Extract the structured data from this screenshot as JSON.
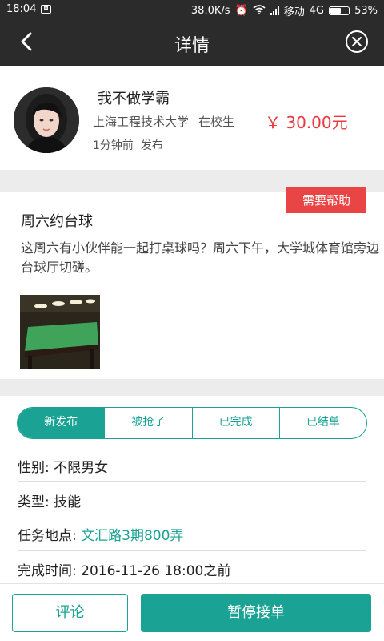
{
  "status_bar": {
    "time": "18:04",
    "left_icon": "sd-card-icon",
    "network_speed": "38.0K/s",
    "carrier": "移动",
    "network_type": "4G",
    "battery_percent": "53%",
    "battery_level": 0.53
  },
  "header": {
    "title": "详情"
  },
  "profile": {
    "username": "我不做学霸",
    "school": "上海工程技术大学",
    "student_status": "在校生",
    "price": "￥ 30.00元",
    "posted_time": "1分钟前",
    "posted_label": "发布"
  },
  "post": {
    "tag": "需要帮助",
    "title": "周六约台球",
    "body": "这周六有小伙伴能一起打桌球吗？周六下午，大学城体育馆旁边台球厅切磋。"
  },
  "progress": {
    "tabs": [
      "新发布",
      "被抢了",
      "已完成",
      "已结单"
    ],
    "active_index": 0
  },
  "details": {
    "gender_label": "性别:",
    "gender_value": "不限男女",
    "type_label": "类型:",
    "type_value": "技能",
    "location_label": "任务地点:",
    "location_value": "文汇路3期800弄",
    "deadline_label": "完成时间:",
    "deadline_value": "2016-11-26 18:00之前"
  },
  "actions": {
    "comment_label": "评论",
    "pause_label": "暂停接单"
  },
  "colors": {
    "accent": "#1aa394",
    "price": "#e8383d",
    "tag": "#e94545",
    "header_bg": "#2b2b2b"
  }
}
